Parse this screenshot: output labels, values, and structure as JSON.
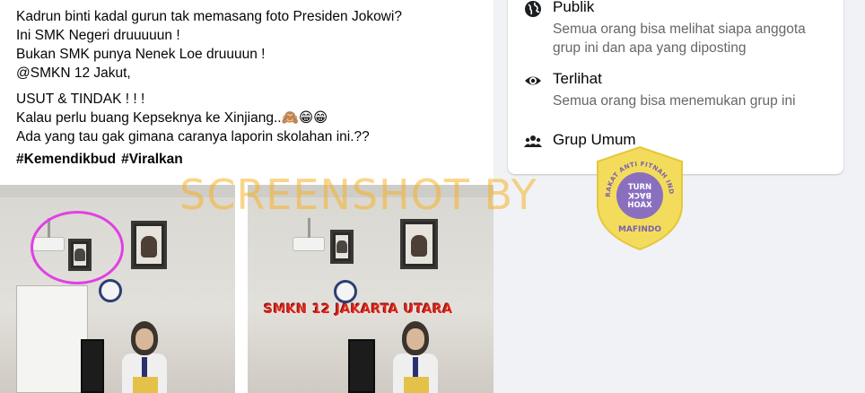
{
  "post": {
    "lines": [
      "Kadrun binti kadal gurun tak memasang foto Presiden Jokowi?",
      "Ini SMK Negeri druuuuun !",
      "Bukan SMK punya Nenek Loe druuuun !",
      "@SMKN 12 Jakut,"
    ],
    "lines2": [
      "USUT & TINDAK ! ! !",
      "Kalau perlu buang Kepseknya ke Xinjiang..🙈😁😁",
      "Ada yang tau gak gimana caranya laporin skolahan ini.??"
    ],
    "hashtags": [
      "#Kemendikbud",
      "#Viralkan"
    ],
    "photo_caption": "SMKN 12 JAKARTA UTARA"
  },
  "about": {
    "items": [
      {
        "icon": "globe-icon",
        "title": "Publik",
        "desc": "Semua orang bisa melihat siapa anggota grup ini dan apa yang diposting"
      },
      {
        "icon": "eye-icon",
        "title": "Terlihat",
        "desc": "Semua orang bisa menemukan grup ini"
      },
      {
        "icon": "people-icon",
        "title": "Grup Umum",
        "desc": ""
      }
    ]
  },
  "watermark": {
    "text": "SCREENSHOT BY",
    "badge_top": "MASYARAKAT ANTI FITNAH INDONESIA",
    "badge_center": [
      "TURN",
      "BACK",
      "HOAX"
    ],
    "badge_bottom": "MAFINDO",
    "color": "#f5b228",
    "badge_color": "#f3dc5c"
  },
  "colors": {
    "text_primary": "#050505",
    "text_secondary": "#65676b",
    "highlight": "#e040e6",
    "caption": "#d8281d",
    "page_bg": "#f0f2f5"
  }
}
